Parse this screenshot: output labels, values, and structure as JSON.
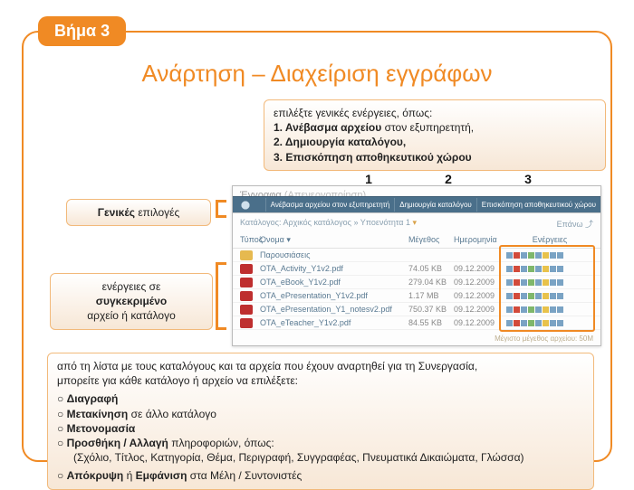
{
  "step_label": "Βήμα 3",
  "title": "Ανάρτηση – Διαχείριση εγγράφων",
  "callout_top": {
    "intro": "επιλέξτε γενικές ενέργειες, όπως:",
    "l1": "1. Ανέβασμα αρχείου",
    "l1_tail": " στον εξυπηρετητή,",
    "l2": "2. Δημιουργία καταλόγου,",
    "l3": "3. Επισκόπηση αποθηκευτικού χώρου"
  },
  "callout_left1": {
    "bold": "Γενικές",
    "rest": " επιλογές"
  },
  "callout_left2": {
    "l1": "ενέργειες σε",
    "l2": "συγκεκριμένο",
    "l3": "αρχείο ή κατάλογο"
  },
  "callout_bottom": {
    "intro1": "από τη λίστα με τους καταλόγους και τα αρχεία που έχουν αναρτηθεί για τη Συνεργασία,",
    "intro2": "μπορείτε για κάθε κατάλογο ή αρχείο να επιλέξετε:",
    "b1": "Διαγραφή",
    "b2_a": "Μετακίνηση",
    "b2_b": " σε άλλο κατάλογο",
    "b3": "Μετονομασία",
    "b4_a": "Προσθήκη / Αλλαγή",
    "b4_b": " πληροφοριών, όπως:",
    "b4_sub": "(Σχόλιο, Τίτλος, Κατηγορία, Θέμα, Περιγραφή, Συγγραφέας, Πνευματικά Δικαιώματα, Γλώσσα)",
    "b5_a": "Απόκρυψη",
    "b5_mid": " ή ",
    "b5_b": "Εμφάνιση",
    "b5_tail": " στα Μέλη / Συντονιστές"
  },
  "numbers": {
    "n1": "1",
    "n2": "2",
    "n3": "3"
  },
  "shot": {
    "panel_title": "Έγγραφα",
    "panel_state": "(Απενεργοποίηση)",
    "action1": "Ανέβασμα αρχείου στον εξυπηρετητή",
    "action2": "Δημιουργία καταλόγου",
    "action3": "Επισκόπηση αποθηκευτικού χώρου",
    "crumb": "Κατάλογος: Αρχικός κατάλογος » Υποενότητα 1",
    "back": "Επάνω",
    "th_type": "Τύπος",
    "th_name": "Όνομα",
    "th_size": "Μέγεθος",
    "th_date": "Ημερομηνία",
    "th_act": "Ενέργειες",
    "rows": [
      {
        "name": "Παρουσιάσεις",
        "size": "",
        "date": "",
        "folder": true
      },
      {
        "name": "OTA_Activity_Y1v2.pdf",
        "size": "74.05 KB",
        "date": "09.12.2009"
      },
      {
        "name": "OTA_eBook_Y1v2.pdf",
        "size": "279.04 KB",
        "date": "09.12.2009"
      },
      {
        "name": "OTA_ePresentation_Y1v2.pdf",
        "size": "1.17 MB",
        "date": "09.12.2009"
      },
      {
        "name": "OTA_ePresentation_Y1_notesv2.pdf",
        "size": "750.37 KB",
        "date": "09.12.2009"
      },
      {
        "name": "OTA_eTeacher_Y1v2.pdf",
        "size": "84.55 KB",
        "date": "09.12.2009"
      }
    ],
    "footer": "Μέγιστο μέγεθος αρχείου: 50M"
  }
}
